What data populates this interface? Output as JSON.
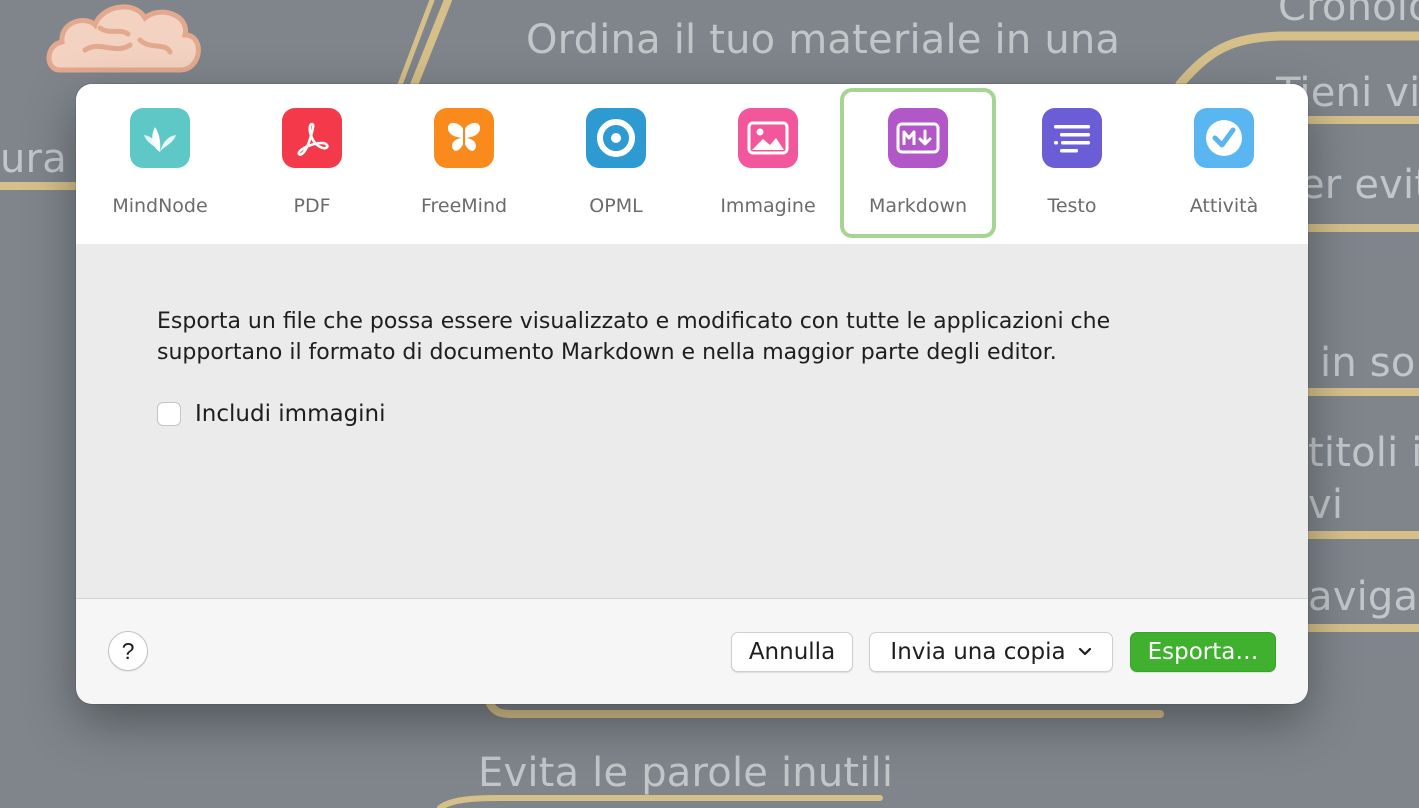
{
  "background": {
    "node_texts": [
      "Ordina il tuo materiale in una",
      "Cronolo",
      "Tieni vi",
      "ura i",
      "er evit",
      "in so",
      "titoli i",
      "vi",
      "avigab",
      "Evita le parole inutili"
    ],
    "branch_color": "#d6c08a"
  },
  "dialog": {
    "formats": [
      {
        "label": "MindNode",
        "icon": "mindnode-leaf-icon",
        "color": "#5dc8c6"
      },
      {
        "label": "PDF",
        "icon": "pdf-icon",
        "color": "#f43a4a"
      },
      {
        "label": "FreeMind",
        "icon": "butterfly-icon",
        "color": "#fb8a1d"
      },
      {
        "label": "OPML",
        "icon": "target-icon",
        "color": "#2e9ad2"
      },
      {
        "label": "Immagine",
        "icon": "image-icon",
        "color": "#f2579b"
      },
      {
        "label": "Markdown",
        "icon": "markdown-icon",
        "color": "#b257c8"
      },
      {
        "label": "Testo",
        "icon": "text-lines-icon",
        "color": "#6a5dd6"
      },
      {
        "label": "Attività",
        "icon": "checkmark-icon",
        "color": "#5ab6f1"
      }
    ],
    "selected_format": "Markdown",
    "description_line1": "Esporta un file che possa essere visualizzato e modificato con tutte le applicazioni che",
    "description_line2": "supportano il formato di documento Markdown e nella maggior parte degli editor.",
    "include_images_label": "Includi immagini",
    "include_images_checked": false,
    "help_label": "?",
    "cancel_label": "Annulla",
    "send_copy_label": "Invia una copia",
    "export_label": "Esporta…",
    "accent_color": "#3fb12f",
    "selection_color": "#a6d593"
  }
}
